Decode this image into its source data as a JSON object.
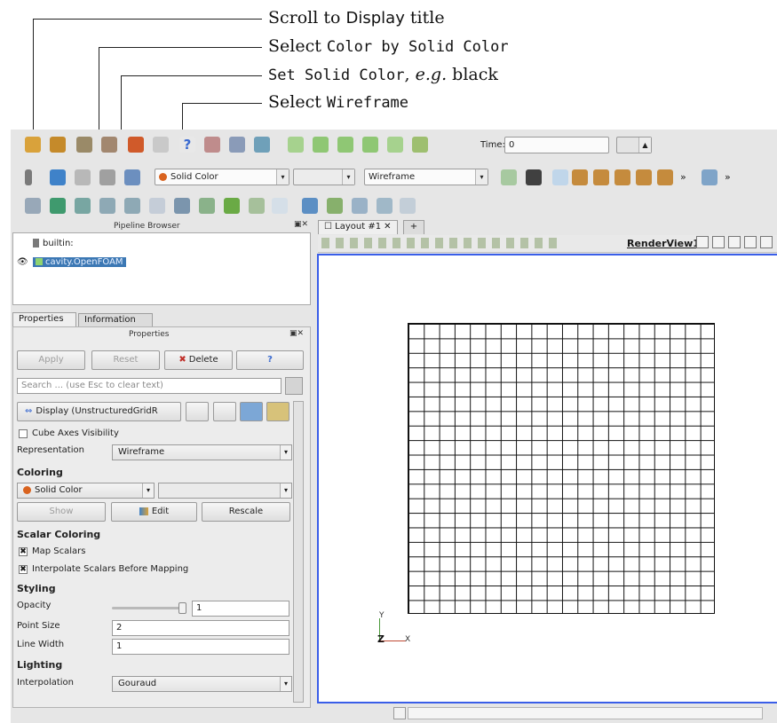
{
  "annotations": {
    "scroll_prefix": "Scroll to ",
    "scroll_target": "Display",
    "scroll_suffix": " title",
    "color_by_prefix": "Select ",
    "color_by_target": "Color by Solid Color",
    "solid_color_prefix": "Set Solid Color",
    "solid_color_eg": "e.g.",
    "solid_color_value": " black",
    "wireframe_prefix": "Select ",
    "wireframe_target": "Wireframe"
  },
  "toolbar": {
    "time_label": "Time:",
    "time_value": "0",
    "color_combo": "Solid Color",
    "representation_combo": "Wireframe",
    "more": "»"
  },
  "pipeline_browser": {
    "title": "Pipeline Browser",
    "items": [
      {
        "label": "builtin:"
      },
      {
        "label": "cavity.OpenFOAM"
      }
    ]
  },
  "tabs": {
    "properties": "Properties",
    "information": "Information"
  },
  "properties": {
    "title": "Properties",
    "apply": "Apply",
    "reset": "Reset",
    "delete": "Delete",
    "help": "?",
    "search_placeholder": "Search ... (use Esc to clear text)",
    "display_button": "Display (UnstructuredGridR",
    "cube_axes": "Cube Axes Visibility",
    "representation_label": "Representation",
    "representation_value": "Wireframe",
    "coloring_section": "Coloring",
    "coloring_value": "Solid Color",
    "show_button": "Show",
    "edit_button": "Edit",
    "rescale_button": "Rescale",
    "scalar_coloring_section": "Scalar Coloring",
    "map_scalars": "Map Scalars",
    "interpolate_scalars": "Interpolate Scalars Before Mapping",
    "styling_section": "Styling",
    "opacity_label": "Opacity",
    "opacity_value": "1",
    "opacity_level": 1,
    "point_size_label": "Point Size",
    "point_size_value": "2",
    "line_width_label": "Line Width",
    "line_width_value": "1",
    "lighting_section": "Lighting",
    "interpolation_label": "Interpolation",
    "interpolation_value": "Gouraud"
  },
  "layout": {
    "tab_label": "Layout #1",
    "add_tab": "+",
    "render_view": "RenderView1",
    "axis_y": "Y",
    "axis_z": "Z",
    "axis_x": "X"
  },
  "colors": {
    "selection": "#3c78b4",
    "render_border": "#3a5ee8",
    "solid_color_swatch": "#d9631f"
  }
}
